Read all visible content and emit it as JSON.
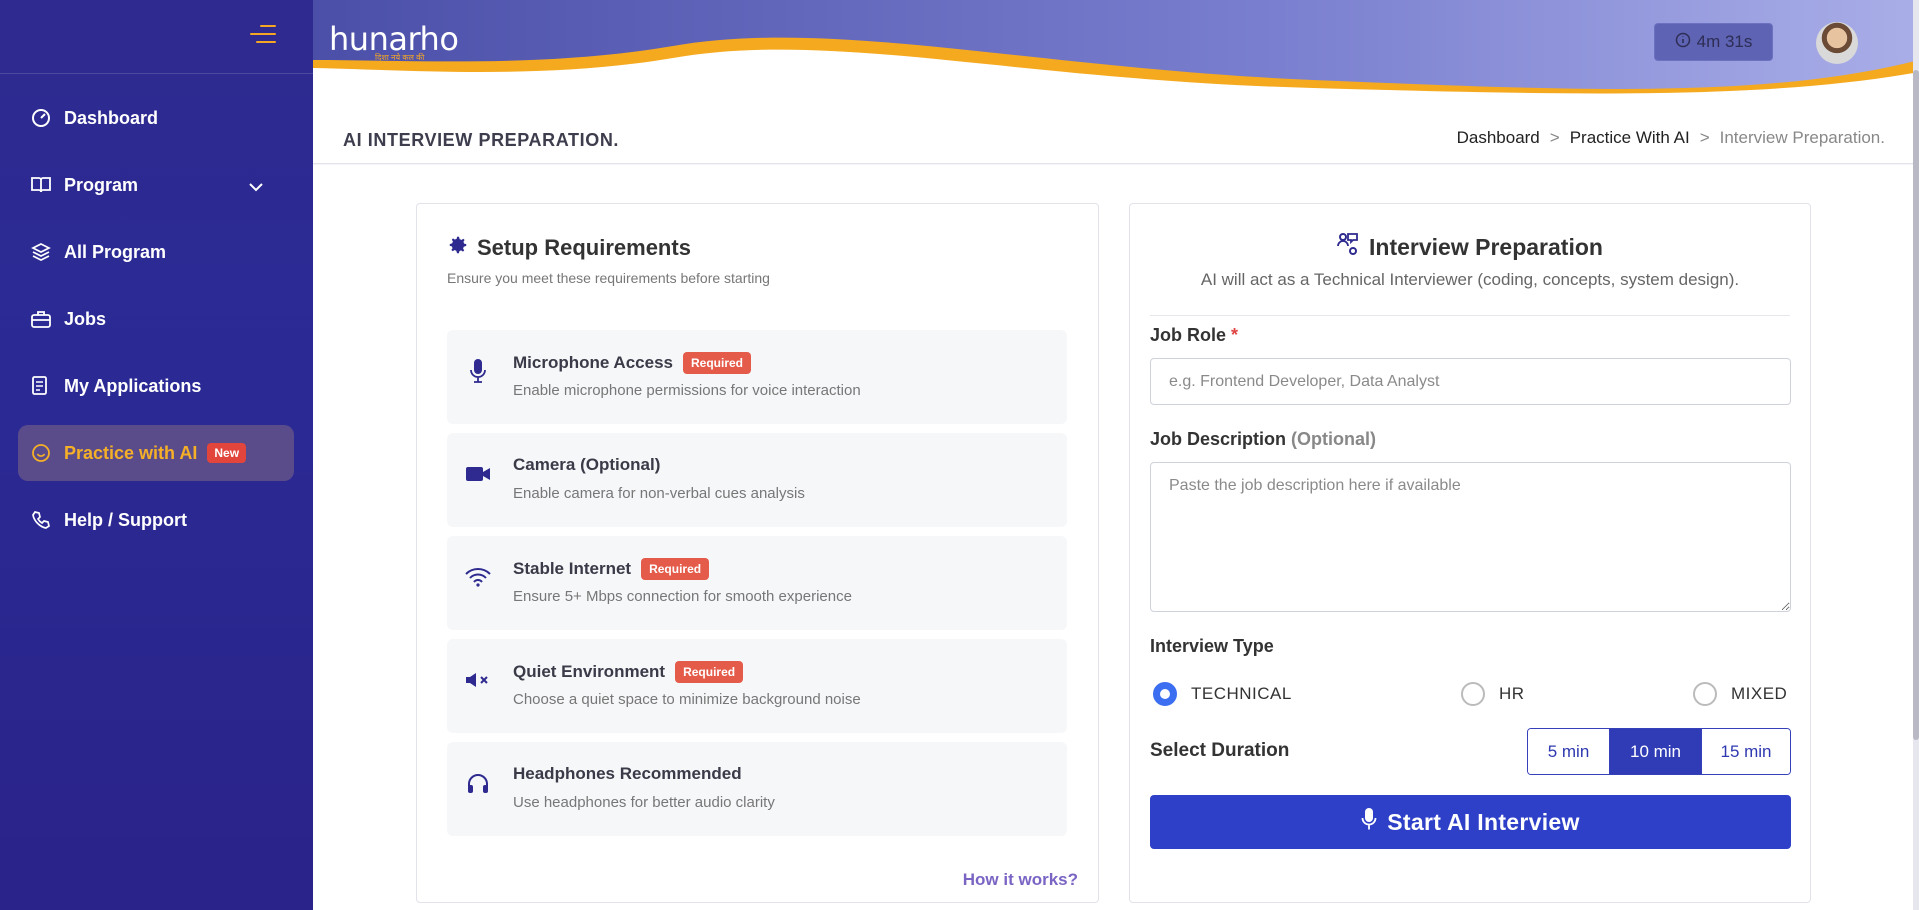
{
  "brand": {
    "logo_text": "hunarho",
    "logo_tagline": "दिशा नये कल की"
  },
  "sidebar": {
    "items": [
      {
        "label": "Dashboard",
        "icon": "gauge-icon"
      },
      {
        "label": "Program",
        "icon": "book-icon"
      },
      {
        "label": "All Program",
        "icon": "layers-icon"
      },
      {
        "label": "Jobs",
        "icon": "briefcase-icon"
      },
      {
        "label": "My Applications",
        "icon": "document-list-icon"
      },
      {
        "label": "Practice with AI",
        "icon": "chat-bubble-icon",
        "badge": "New",
        "active": true
      },
      {
        "label": "Help / Support",
        "icon": "phone-icon"
      }
    ]
  },
  "header": {
    "timer": "4m 31s"
  },
  "page": {
    "title": "AI INTERVIEW PREPARATION.",
    "breadcrumb": [
      "Dashboard",
      "Practice With AI",
      "Interview Preparation."
    ]
  },
  "setup": {
    "title": "Setup Requirements",
    "subtitle": "Ensure you meet these requirements before starting",
    "requirements": [
      {
        "name": "Microphone Access",
        "badge": "Required",
        "desc": "Enable microphone permissions for voice interaction",
        "icon": "microphone-icon"
      },
      {
        "name": "Camera (Optional)",
        "badge": "",
        "desc": "Enable camera for non-verbal cues analysis",
        "icon": "video-camera-icon"
      },
      {
        "name": "Stable Internet",
        "badge": "Required",
        "desc": "Ensure 5+ Mbps connection for smooth experience",
        "icon": "wifi-icon"
      },
      {
        "name": "Quiet Environment",
        "badge": "Required",
        "desc": "Choose a quiet space to minimize background noise",
        "icon": "mute-speaker-icon"
      },
      {
        "name": "Headphones Recommended",
        "badge": "",
        "desc": "Use headphones for better audio clarity",
        "icon": "headphones-icon"
      }
    ],
    "how_link": "How it works?"
  },
  "interview": {
    "title": "Interview Preparation",
    "subtitle": "AI will act as a Technical Interviewer (coding, concepts, system design).",
    "job_role_label": "Job Role",
    "required_mark": "*",
    "job_role_placeholder": "e.g. Frontend Developer, Data Analyst",
    "job_role_value": "",
    "job_desc_label": "Job Description",
    "job_desc_optional": "(Optional)",
    "job_desc_placeholder": "Paste the job description here if available",
    "type_label": "Interview Type",
    "types": [
      "TECHNICAL",
      "HR",
      "MIXED"
    ],
    "selected_type": "TECHNICAL",
    "duration_label": "Select Duration",
    "durations": [
      "5 min",
      "10 min",
      "15 min"
    ],
    "selected_duration": "10 min",
    "start_label": "Start AI Interview"
  },
  "colors": {
    "sidebar": "#2b2a95",
    "accent": "#f5a623",
    "primary": "#2f40c8",
    "required": "#e45b4a"
  }
}
